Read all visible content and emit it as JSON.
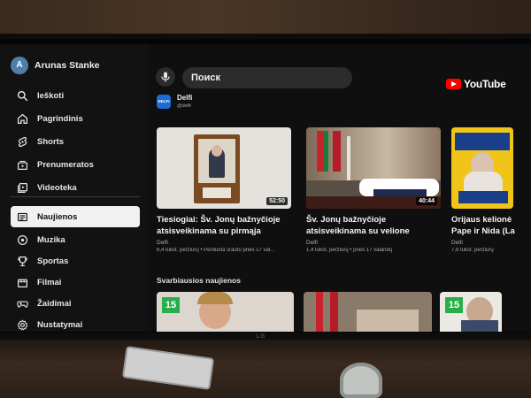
{
  "profile": {
    "initial": "A",
    "name": "Arunas Stanke"
  },
  "nav": {
    "items": [
      {
        "label": "Ieškoti",
        "icon": "search-icon"
      },
      {
        "label": "Pagrindinis",
        "icon": "home-icon"
      },
      {
        "label": "Shorts",
        "icon": "shorts-icon"
      },
      {
        "label": "Prenumeratos",
        "icon": "subscriptions-icon"
      },
      {
        "label": "Videoteka",
        "icon": "library-icon"
      },
      {
        "label": "Naujienos",
        "icon": "news-icon",
        "active": true
      },
      {
        "label": "Muzika",
        "icon": "music-icon"
      },
      {
        "label": "Sportas",
        "icon": "trophy-icon"
      },
      {
        "label": "Filmai",
        "icon": "film-icon"
      },
      {
        "label": "Žaidimai",
        "icon": "gaming-icon"
      },
      {
        "label": "Nustatymai",
        "icon": "gear-icon"
      }
    ]
  },
  "search": {
    "value": "Поиск"
  },
  "brand": {
    "logo_text": "YouTube",
    "accent": "#ff0000"
  },
  "channel": {
    "logo_text": "DELFI",
    "name": "Delfi",
    "handle": "@delfi"
  },
  "videos": [
    {
      "duration": "52:50",
      "title": "Tiesiogiai: Šv. Jonų bažnyčioje atsisveikinama su pirmąja",
      "channel": "Delfi",
      "meta": "6,4 tūkst. peržiūrų • Perduota srautu prieš 17 val..."
    },
    {
      "duration": "40:44",
      "title": "Šv. Jonų bažnyčioje atsisveikinama su velione",
      "channel": "Delfi",
      "meta": "1,4 tūkst. peržiūrų • prieš 17 valandų"
    },
    {
      "title": "Orijaus kelionė Pape ir Nida (La",
      "channel": "Delfi",
      "meta": "7,9 tūkst. peržiūrų"
    }
  ],
  "section": {
    "title": "Svarbiausios naujienos"
  },
  "row2": {
    "badge": "15"
  },
  "tv": {
    "brand": "LG"
  }
}
